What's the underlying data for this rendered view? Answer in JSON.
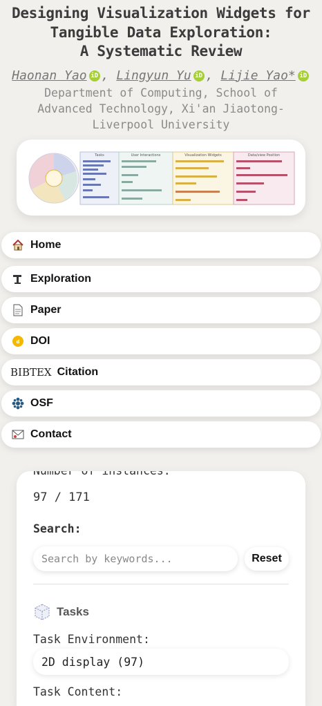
{
  "header": {
    "title_lines": [
      "Designing Visualization Widgets for",
      "Tangible Data Exploration:",
      "A Systematic Review"
    ],
    "authors": [
      {
        "name": "Haonan Yao",
        "orcid": "iD"
      },
      {
        "name": "Lingyun Yu",
        "orcid": "iD"
      },
      {
        "name": "Lijie Yao*",
        "orcid": "iD"
      }
    ],
    "separator": ",",
    "affiliation_lines": [
      "Department of Computing, School of",
      "Advanced Technology, Xi'an Jiaotong-",
      "Liverpool University"
    ]
  },
  "teaser": {
    "columns": [
      "Tasks",
      "User Interactions",
      "Visualization Widgets",
      "Data/view Position"
    ],
    "colors": [
      "#6a77b5",
      "#8aa9a0",
      "#d8b046",
      "#b8506a"
    ]
  },
  "nav": {
    "items": [
      {
        "label": "Home",
        "icon": "house-icon"
      },
      {
        "label": "Exploration",
        "icon": "microscope-icon"
      },
      {
        "label": "Paper",
        "icon": "document-icon"
      },
      {
        "label": "DOI",
        "icon": "doi-icon"
      },
      {
        "label": "Citation",
        "icon": "bibtex-icon",
        "prefix": "BIBTEX"
      },
      {
        "label": "OSF",
        "icon": "osf-icon"
      },
      {
        "label": "Contact",
        "icon": "mail-icon"
      }
    ]
  },
  "panel": {
    "instances_label": "Number of instances:",
    "instances_value": "97 / 171",
    "search_label": "Search:",
    "search_placeholder": "Search by keywords...",
    "reset_label": "Reset",
    "tasks_title": "Tasks",
    "task_env_label": "Task Environment:",
    "task_env_value": "2D display (97)",
    "task_content_label": "Task Content:"
  }
}
